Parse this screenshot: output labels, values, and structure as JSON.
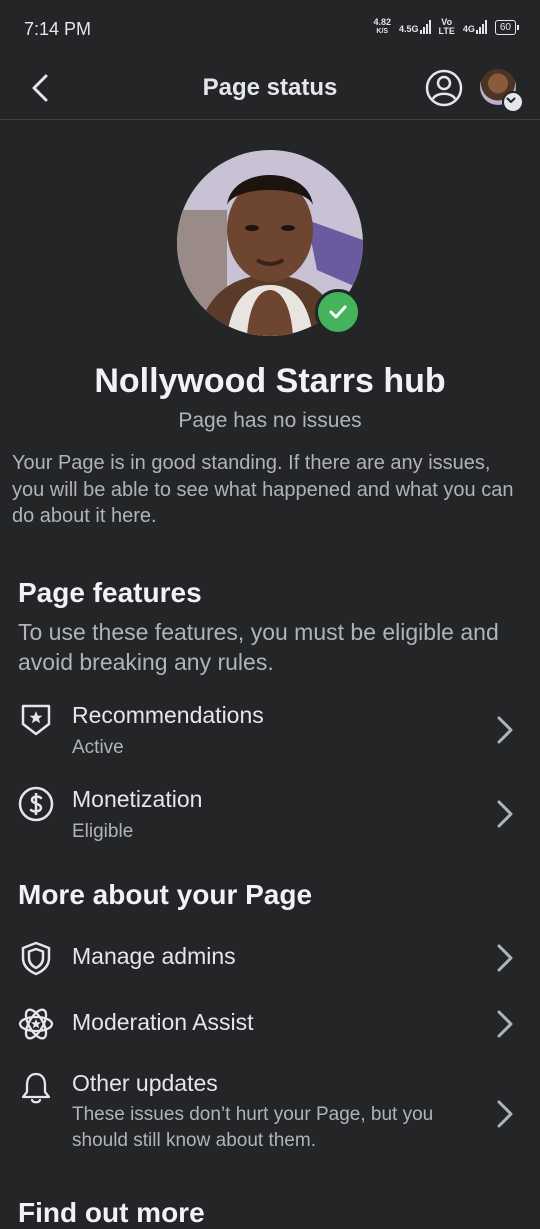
{
  "status_bar": {
    "time": "7:14 PM",
    "net_speed_value": "4.82",
    "net_speed_unit": "K/S",
    "sim1_label": "4.5G",
    "volte_top": "Vo",
    "volte_bottom": "LTE",
    "sim2_label": "4G",
    "battery": "60"
  },
  "header": {
    "title": "Page status"
  },
  "profile": {
    "name": "Nollywood Starrs hub",
    "status": "Page has no issues",
    "description": "Your Page is in good standing. If there are any issues, you will be able to see what happened and what you can do about it here."
  },
  "features": {
    "title": "Page features",
    "subtitle": "To use these features, you must be eligible and avoid breaking any rules.",
    "items": [
      {
        "title": "Recommendations",
        "status": "Active",
        "icon": "shield-star-icon"
      },
      {
        "title": "Monetization",
        "status": "Eligible",
        "icon": "dollar-circle-icon"
      }
    ]
  },
  "more": {
    "title": "More about your Page",
    "items": [
      {
        "title": "Manage admins",
        "icon": "shield-icon"
      },
      {
        "title": "Moderation Assist",
        "icon": "atom-icon"
      },
      {
        "title": "Other updates",
        "subtitle": "These issues don’t hurt your Page, but you should still know about them.",
        "icon": "bell-icon"
      }
    ]
  },
  "find_out_more": {
    "title": "Find out more"
  },
  "colors": {
    "background": "#242526",
    "success": "#44b35c",
    "text_primary": "#e4e6eb",
    "text_secondary": "#b0b3b8"
  }
}
